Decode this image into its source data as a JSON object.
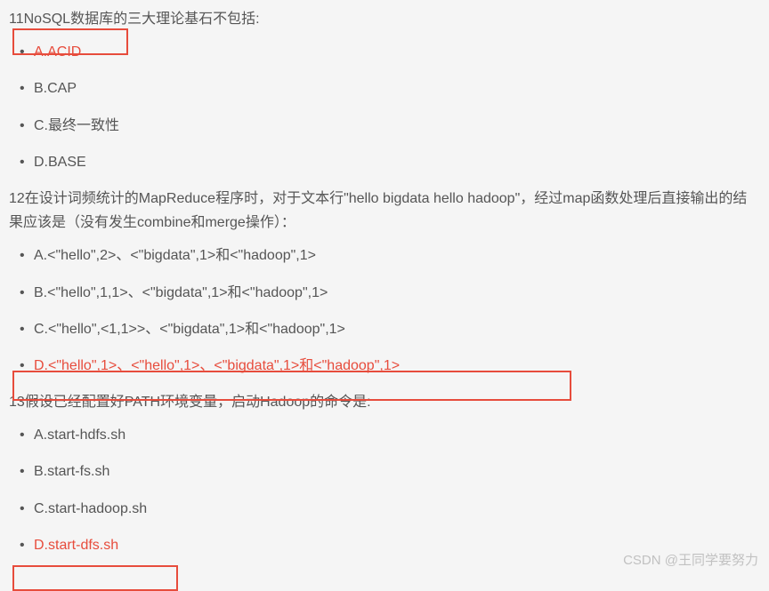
{
  "questions": [
    {
      "text": "11NoSQL数据库的三大理论基石不包括:",
      "options": [
        {
          "label": "A.ACID",
          "answer": true
        },
        {
          "label": "B.CAP",
          "answer": false
        },
        {
          "label": "C.最终一致性",
          "answer": false
        },
        {
          "label": "D.BASE",
          "answer": false
        }
      ]
    },
    {
      "text": "12在设计词频统计的MapReduce程序时，对于文本行\"hello bigdata hello hadoop\"，经过map函数处理后直接输出的结果应该是（没有发生combine和merge操作）：",
      "options": [
        {
          "label": "A.<\"hello\",2>、<\"bigdata\",1>和<\"hadoop\",1>",
          "answer": false
        },
        {
          "label": "B.<\"hello\",1,1>、<\"bigdata\",1>和<\"hadoop\",1>",
          "answer": false
        },
        {
          "label": "C.<\"hello\",<1,1>>、<\"bigdata\",1>和<\"hadoop\",1>",
          "answer": false
        },
        {
          "label": "D.<\"hello\",1>、<\"hello\",1>、<\"bigdata\",1>和<\"hadoop\",1>",
          "answer": true
        }
      ]
    },
    {
      "text": "13假设已经配置好PATH环境变量，启动Hadoop的命令是:",
      "options": [
        {
          "label": "A.start-hdfs.sh",
          "answer": false
        },
        {
          "label": "B.start-fs.sh",
          "answer": false
        },
        {
          "label": "C.start-hadoop.sh",
          "answer": false
        },
        {
          "label": "D.start-dfs.sh",
          "answer": true
        }
      ]
    }
  ],
  "watermark": "CSDN @王同学要努力"
}
